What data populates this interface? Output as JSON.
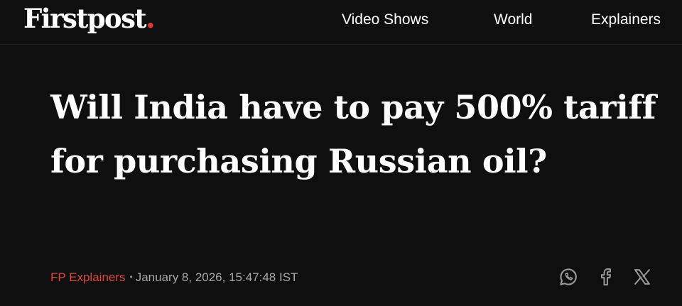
{
  "header": {
    "logo_text": "Firstpost",
    "logo_dot": ".",
    "nav": [
      {
        "label": "Video Shows"
      },
      {
        "label": "World"
      },
      {
        "label": "Explainers"
      }
    ]
  },
  "article": {
    "headline": "Will India have to pay 500% tariff for purchasing Russian oil?",
    "category": "FP Explainers",
    "separator": "•",
    "date": "January 8, 2026, 15:47:48 IST"
  },
  "share": {
    "icons": [
      "whatsapp-icon",
      "facebook-icon",
      "x-icon"
    ]
  },
  "colors": {
    "background": "#0f0f0f",
    "brand_red": "#e53935",
    "category_red": "#e2463a",
    "meta_gray": "#a8a8a8",
    "icon_gray": "#9a9a9a"
  }
}
